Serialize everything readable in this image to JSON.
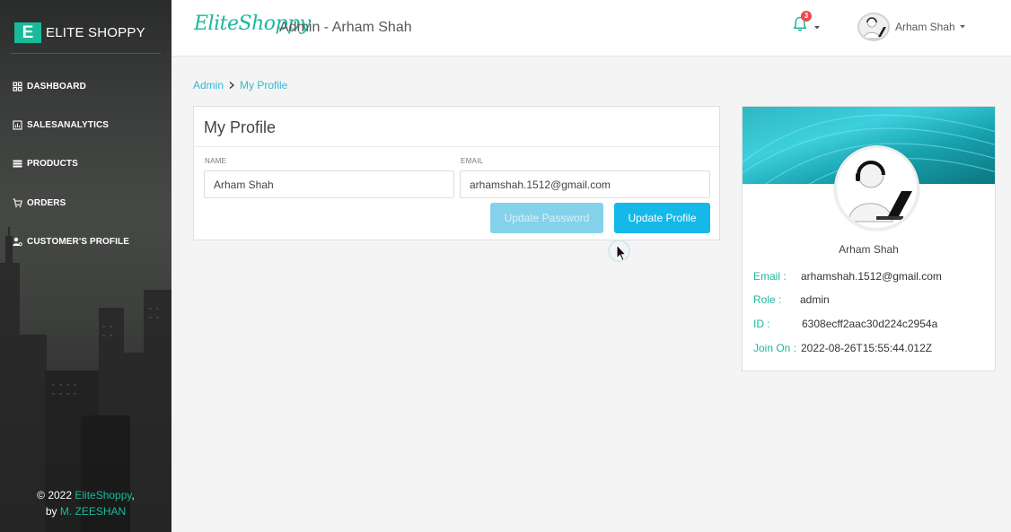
{
  "sidebar": {
    "brand_logo": "E",
    "brand_text": "ELITE SHOPPY",
    "items": [
      {
        "label": "DASHBOARD",
        "icon": "dashboard-icon"
      },
      {
        "label": "SALESANALYTICS",
        "icon": "chart-icon"
      },
      {
        "label": "PRODUCTS",
        "icon": "list-icon"
      },
      {
        "label": "ORDERS",
        "icon": "cart-icon"
      },
      {
        "label": "CUSTOMER'S PROFILE",
        "icon": "users-gear-icon"
      }
    ],
    "footer": {
      "copyright": "© 2022 ",
      "brand": "EliteShoppy",
      "comma": ",",
      "by": "by ",
      "author": "M. ZEESHAN"
    }
  },
  "header": {
    "logo": "EliteShoppy",
    "title": "Admin - Arham Shah",
    "notification_count": "3",
    "user_name": "Arham Shah"
  },
  "breadcrumb": {
    "root": "Admin",
    "current": "My Profile"
  },
  "profile_form": {
    "title": "My Profile",
    "name_label": "NAME",
    "name_value": "Arham Shah",
    "email_label": "EMAIL",
    "email_value": "arhamshah.1512@gmail.com",
    "update_password_label": "Update Password",
    "update_profile_label": "Update Profile"
  },
  "profile_card": {
    "name": "Arham Shah",
    "email_key": "Email :",
    "email_value": "arhamshah.1512@gmail.com",
    "role_key": "Role :",
    "role_value": "admin",
    "id_key": "ID :",
    "id_value": "6308ecff2aac30d224c2954a",
    "join_key": "Join On :",
    "join_value": "2022-08-26T15:55:44.012Z"
  },
  "colors": {
    "accent": "#1ab99b",
    "link": "#36b8d6",
    "primary_button": "#14b8e9",
    "badge": "#e84b4b"
  }
}
